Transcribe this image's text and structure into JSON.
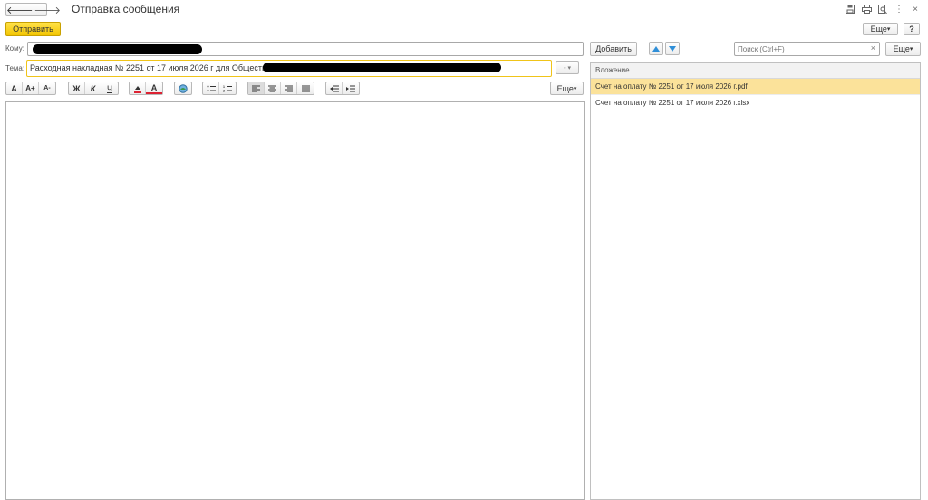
{
  "window": {
    "title": "Отправка сообщения",
    "back_glyph": "🡐",
    "forward_glyph": "🡒",
    "icons": [
      "save-icon",
      "print-icon",
      "preview-icon",
      "more-vertical-icon",
      "close-icon"
    ]
  },
  "toolbar": {
    "send_label": "Отправить",
    "more_label": "Еще",
    "help_label": "?"
  },
  "to": {
    "label": "Кому:",
    "value": ""
  },
  "subject": {
    "label": "Тема:",
    "value": "Расходная накладная № 2251 от 17 июля 2026 г для Общество с огр"
  },
  "format": {
    "groups": [
      [
        "A",
        "A+",
        "A-"
      ],
      [
        "Ж",
        "К",
        "Ч"
      ],
      [
        "bg-color",
        "A"
      ],
      [
        "image"
      ],
      [
        "bullet-list",
        "numbered-list"
      ],
      [
        "align-left",
        "align-center",
        "align-right",
        "align-justify"
      ],
      [
        "indent-decrease",
        "indent-increase"
      ]
    ],
    "more_label": "Еще"
  },
  "attachments": {
    "add_label": "Добавить",
    "search_placeholder": "Поиск (Ctrl+F)",
    "more_label": "Еще",
    "column_header": "Вложение",
    "items": [
      {
        "name": "Счет на оплату № 2251 от 17 июля 2026 г.pdf",
        "selected": true
      },
      {
        "name": "Счет на оплату № 2251 от 17 июля 2026 г.xlsx",
        "selected": false
      }
    ]
  },
  "colors": {
    "accent_yellow": "#f2c400",
    "selection": "#fbe29a",
    "arrow_blue": "#2f8fd8"
  }
}
